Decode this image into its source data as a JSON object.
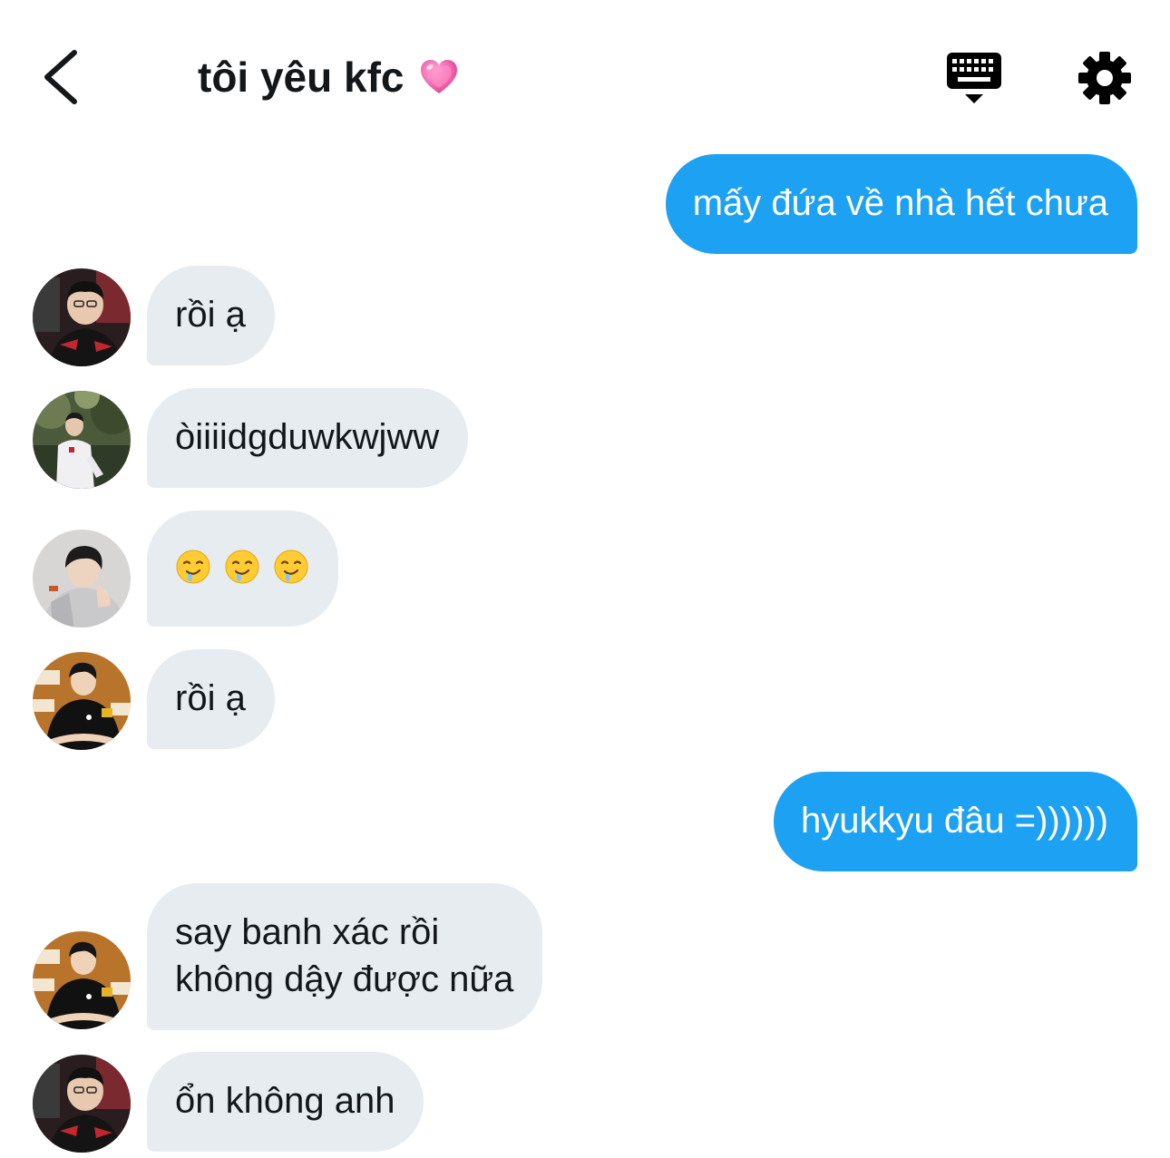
{
  "header": {
    "title": "tôi yêu kfc",
    "title_emoji": "heart-icon"
  },
  "colors": {
    "outgoing_bubble": "#1da1f2",
    "incoming_bubble": "#e6ecf0",
    "text": "#14171a"
  },
  "messages": [
    {
      "direction": "out",
      "text": "mấy đứa về nhà hết chưa"
    },
    {
      "direction": "in",
      "avatar": "avatar-1",
      "text": "rồi ạ"
    },
    {
      "direction": "in",
      "avatar": "avatar-2",
      "text": "òiiiidgduwkwjww"
    },
    {
      "direction": "in",
      "avatar": "avatar-3",
      "text": "",
      "emojis": [
        "drooling-face-icon",
        "drooling-face-icon",
        "drooling-face-icon"
      ]
    },
    {
      "direction": "in",
      "avatar": "avatar-4",
      "text": "rồi ạ"
    },
    {
      "direction": "out",
      "text": "hyukkyu đâu =))))))"
    },
    {
      "direction": "in",
      "avatar": "avatar-4",
      "lines": [
        "say banh xác rồi",
        "không dậy được nữa"
      ]
    },
    {
      "direction": "in",
      "avatar": "avatar-1",
      "text": "ổn không anh"
    }
  ]
}
